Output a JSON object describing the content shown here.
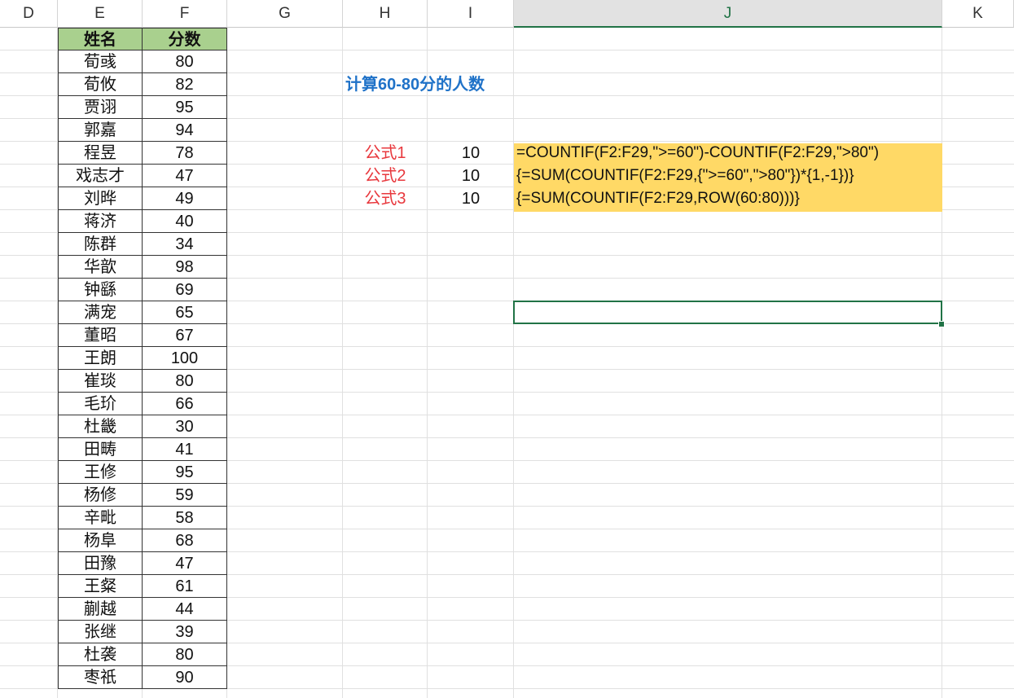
{
  "columns": [
    "D",
    "E",
    "F",
    "G",
    "H",
    "I",
    "J",
    "K"
  ],
  "selected_column": "J",
  "table": {
    "headers": [
      "姓名",
      "分数"
    ],
    "header_color": "#a9d08e",
    "rows": [
      [
        "荀彧",
        "80"
      ],
      [
        "荀攸",
        "82"
      ],
      [
        "贾诩",
        "95"
      ],
      [
        "郭嘉",
        "94"
      ],
      [
        "程昱",
        "78"
      ],
      [
        "戏志才",
        "47"
      ],
      [
        "刘晔",
        "49"
      ],
      [
        "蒋济",
        "40"
      ],
      [
        "陈群",
        "34"
      ],
      [
        "华歆",
        "98"
      ],
      [
        "钟繇",
        "69"
      ],
      [
        "满宠",
        "65"
      ],
      [
        "董昭",
        "67"
      ],
      [
        "王朗",
        "100"
      ],
      [
        "崔琰",
        "80"
      ],
      [
        "毛玠",
        "66"
      ],
      [
        "杜畿",
        "30"
      ],
      [
        "田畴",
        "41"
      ],
      [
        "王修",
        "95"
      ],
      [
        "杨修",
        "59"
      ],
      [
        "辛毗",
        "58"
      ],
      [
        "杨阜",
        "68"
      ],
      [
        "田豫",
        "47"
      ],
      [
        "王粲",
        "61"
      ],
      [
        "蒯越",
        "44"
      ],
      [
        "张继",
        "39"
      ],
      [
        "杜袭",
        "80"
      ],
      [
        "枣祇",
        "90"
      ]
    ]
  },
  "title": {
    "text": "计算60-80分的人数",
    "color": "#1f72c8"
  },
  "formulas": [
    {
      "label": "公式1",
      "result": "10",
      "formula": "=COUNTIF(F2:F29,\">=60\")-COUNTIF(F2:F29,\">80\")"
    },
    {
      "label": "公式2",
      "result": "10",
      "formula": "{=SUM(COUNTIF(F2:F29,{\">=60\",\">80\"})*{1,-1})}"
    },
    {
      "label": "公式3",
      "result": "10",
      "formula": "{=SUM(COUNTIF(F2:F29,ROW(60:80)))}"
    }
  ],
  "colors": {
    "label": "#e8383d",
    "formula_highlight": "#ffd966",
    "selection": "#217346"
  }
}
